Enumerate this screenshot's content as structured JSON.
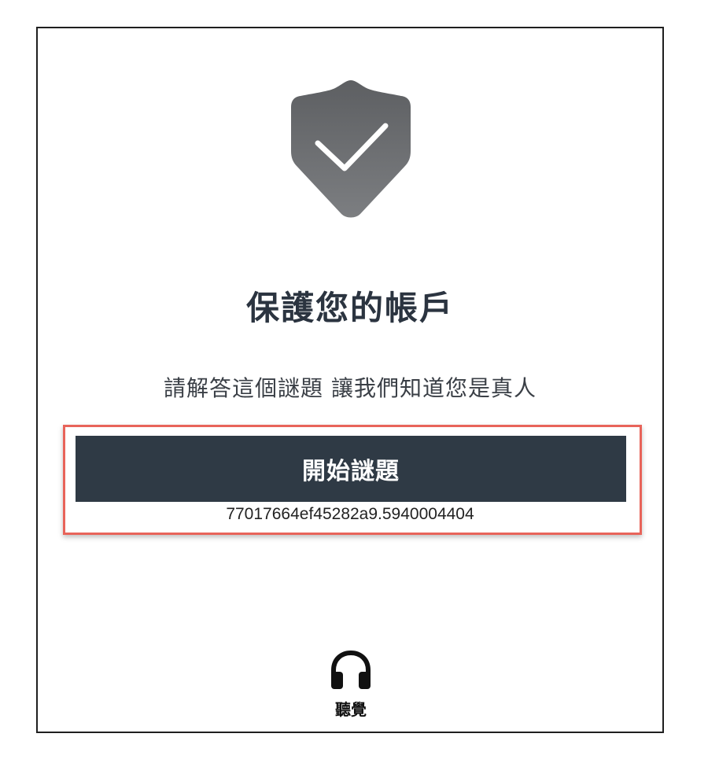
{
  "shield": {
    "icon": "shield-check-icon"
  },
  "heading": {
    "title": "保護您的帳戶"
  },
  "instructions": {
    "text": "請解答這個謎題 讓我們知道您是真人"
  },
  "puzzle": {
    "start_label": "開始謎題",
    "session_id": "77017664ef45282a9.5940004404"
  },
  "audio": {
    "icon": "headphones-icon",
    "label": "聽覺"
  },
  "colors": {
    "button_bg": "#2f3a45",
    "highlight_border": "#e8645a",
    "title_color": "#2b3440"
  }
}
